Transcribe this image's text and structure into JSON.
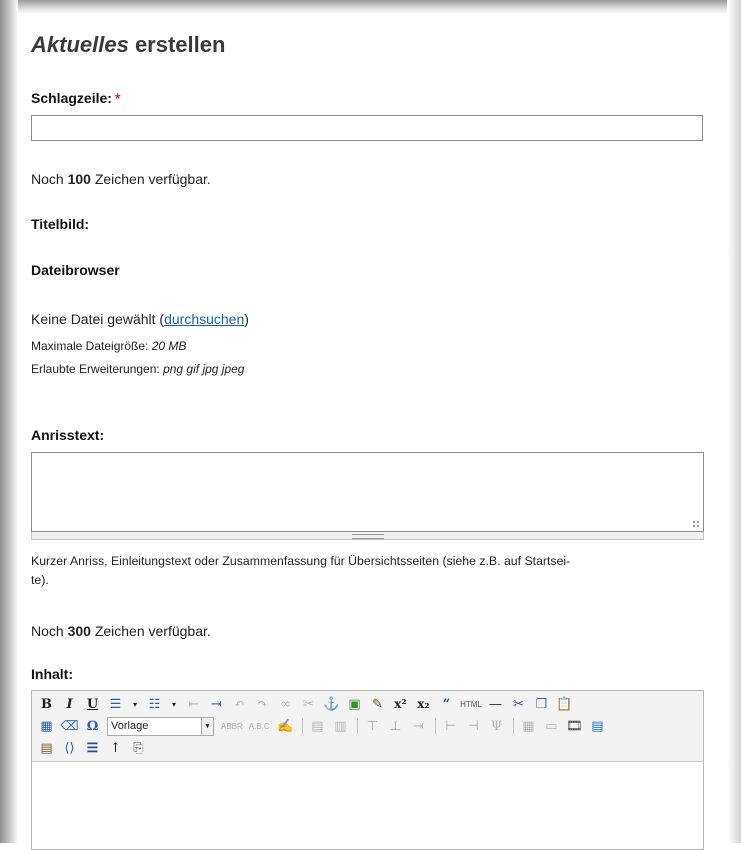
{
  "page": {
    "title_italic": "Aktuelles",
    "title_rest": " erstellen"
  },
  "headline": {
    "label": "Schlagzeile:",
    "required_mark": "*",
    "value": "",
    "remaining_prefix": "Noch ",
    "remaining_count": "100",
    "remaining_suffix": " Zeichen verfügbar."
  },
  "image": {
    "label": "Titelbild:",
    "browser_heading": "Dateibrowser",
    "no_file_text": "Keine Datei gewählt (",
    "browse_link": "durchsuchen",
    "no_file_close": ")",
    "max_size_label": "Maximale Dateigröße: ",
    "max_size_value": "20 MB",
    "extensions_label": "Erlaubte Erweiterungen: ",
    "extensions_value": "png gif jpg jpeg"
  },
  "teaser": {
    "label": "Anrisstext:",
    "value": "",
    "help_line1": "Kurzer Anriss, Einleitungstext oder Zusammenfassung für Übersichtsseiten (siehe z.B. auf Startsei-",
    "help_line2": "te).",
    "remaining_prefix": "Noch ",
    "remaining_count": "300",
    "remaining_suffix": " Zeichen verfügbar."
  },
  "content": {
    "label": "Inhalt:",
    "format_select_value": "Vorlage",
    "toolbar_text_abbr": "ABBR",
    "toolbar_text_abc": "A.B.C.",
    "toolbar_text_html": "HTML"
  },
  "colors": {
    "link": "#1a5fb4",
    "required": "#c0392b",
    "toolbar_bg": "#f3f3f3"
  }
}
